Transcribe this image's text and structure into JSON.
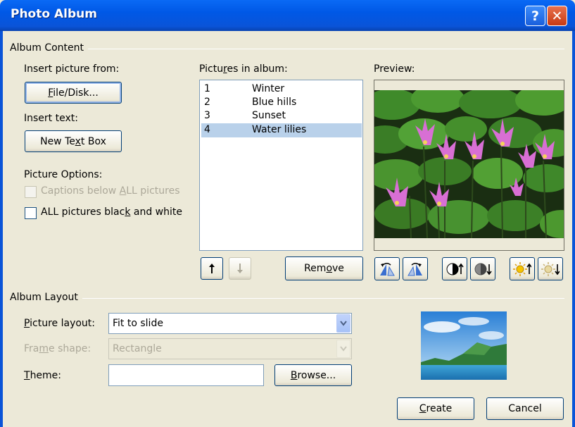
{
  "window": {
    "title": "Photo Album",
    "help_label": "?",
    "close_label": "✕"
  },
  "album_content": {
    "group_label": "Album Content",
    "insert_picture_label": "Insert picture from:",
    "file_disk_button": {
      "pre": "",
      "key": "F",
      "post": "ile/Disk..."
    },
    "insert_text_label": "Insert text:",
    "new_text_box_button": {
      "pre": "New Te",
      "key": "x",
      "post": "t Box"
    },
    "picture_options_label": "Picture Options:",
    "captions_checkbox": {
      "pre": "Captions below ",
      "key": "A",
      "post": "LL pictures",
      "checked": false,
      "enabled": false
    },
    "bw_checkbox": {
      "pre": "ALL pictures blac",
      "key": "k",
      "post": " and white",
      "checked": false,
      "enabled": true
    },
    "pictures_in_album_label": {
      "pre": "Pictu",
      "key": "r",
      "post": "es in album:"
    },
    "pictures": [
      {
        "num": "1",
        "name": "Winter"
      },
      {
        "num": "2",
        "name": "Blue hills"
      },
      {
        "num": "3",
        "name": "Sunset"
      },
      {
        "num": "4",
        "name": "Water lilies"
      }
    ],
    "selected_index": 3,
    "preview_label": "Preview:",
    "remove_button": {
      "pre": "Rem",
      "key": "o",
      "post": "ve"
    }
  },
  "album_layout": {
    "group_label": "Album Layout",
    "picture_layout_label": {
      "pre": "",
      "key": "P",
      "post": "icture layout:"
    },
    "picture_layout_value": "Fit to slide",
    "frame_shape_label": {
      "pre": "Fra",
      "key": "m",
      "post": "e shape:"
    },
    "frame_shape_value": "Rectangle",
    "theme_label": {
      "pre": "",
      "key": "T",
      "post": "heme:"
    },
    "theme_value": "",
    "browse_button": {
      "pre": "",
      "key": "B",
      "post": "rowse..."
    }
  },
  "footer": {
    "create_button": {
      "pre": "",
      "key": "C",
      "post": "reate"
    },
    "cancel_button": "Cancel"
  },
  "colors": {
    "title_bar": "#0a54d8",
    "selected_row": "#b9d1ea",
    "dialog_bg": "#ece9d8"
  }
}
